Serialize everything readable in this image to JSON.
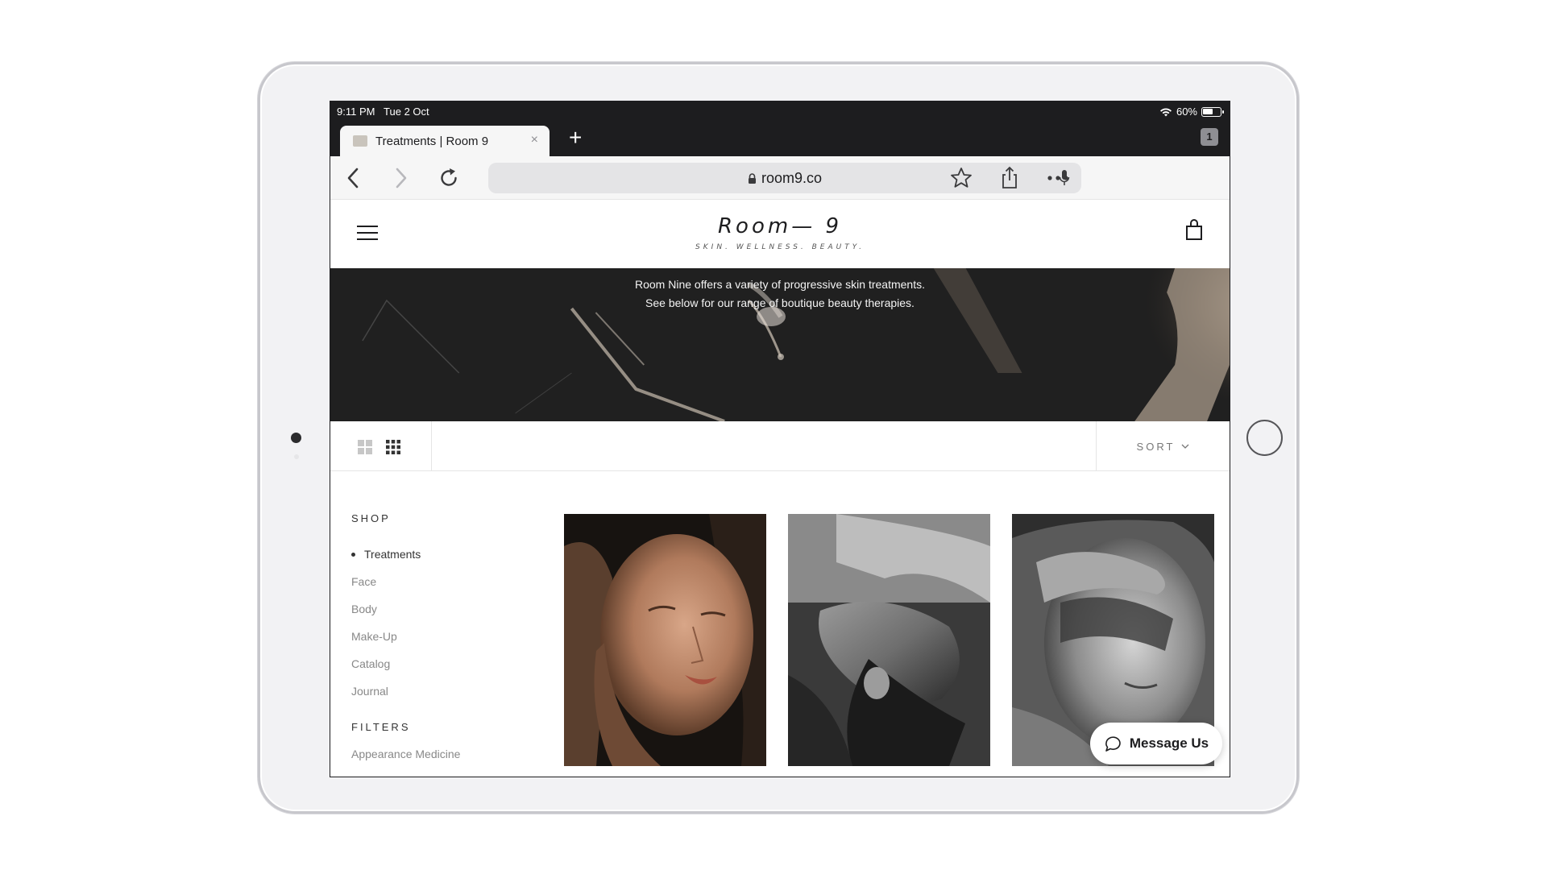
{
  "status_bar": {
    "time_date": "9:11 PM   Tue 2 Oct",
    "battery": "60%",
    "battery_level": 0.6
  },
  "tab_bar": {
    "active_tab_title": "Treatments | Room 9",
    "close_symbol": "×",
    "new_tab_symbol": "+",
    "tab_count": "1"
  },
  "toolbar": {
    "url": "room9.co",
    "icons": [
      "back-icon",
      "forward-icon",
      "reload-icon",
      "lock-icon",
      "microphone-icon",
      "bookmark-star-icon",
      "share-icon",
      "more-icon"
    ]
  },
  "site": {
    "logo": "Room— 9",
    "tagline": "SKIN. WELLNESS. BEAUTY.",
    "icons": [
      "hamburger-menu-icon",
      "shopping-bag-icon"
    ]
  },
  "hero": {
    "line1": "Room Nine offers a variety of progressive skin treatments.",
    "line2": "See below for our range of boutique beauty therapies."
  },
  "view_bar": {
    "sort_label": "SORT",
    "icons": [
      "grid-2x2-icon",
      "grid-3x3-icon",
      "chevron-down-icon"
    ]
  },
  "sidebar": {
    "shop_heading": "SHOP",
    "items": [
      {
        "label": "Treatments",
        "active": true
      },
      {
        "label": "Face",
        "active": false
      },
      {
        "label": "Body",
        "active": false
      },
      {
        "label": "Make-Up",
        "active": false
      },
      {
        "label": "Catalog",
        "active": false
      },
      {
        "label": "Journal",
        "active": false
      }
    ],
    "filters_heading": "FILTERS",
    "filters": [
      "Appearance Medicine"
    ]
  },
  "products": [
    {
      "image": "portrait-eyes-closed-color"
    },
    {
      "image": "portrait-head-tilted-bw"
    },
    {
      "image": "portrait-hand-on-forehead-bw"
    }
  ],
  "chat": {
    "label": "Message Us"
  },
  "colors": {
    "chrome_dark": "#1d1d1f",
    "toolbar_bg": "#f6f6f6",
    "url_field": "#e4e4e6",
    "text_muted": "#888888"
  }
}
